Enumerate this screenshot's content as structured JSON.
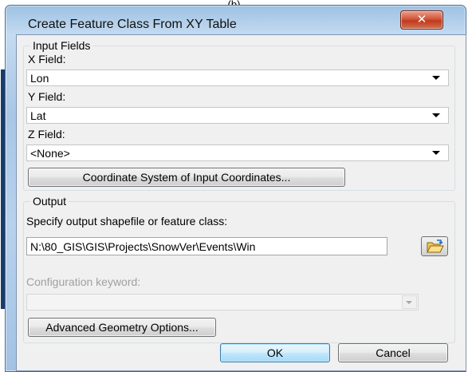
{
  "top_caption": "(b)",
  "window": {
    "title": "Create Feature Class From XY Table",
    "close_glyph": "✕"
  },
  "input_fields": {
    "legend": "Input Fields",
    "x_label": "X Field:",
    "x_value": "Lon",
    "y_label": "Y Field:",
    "y_value": "Lat",
    "z_label": "Z Field:",
    "z_value": "<None>",
    "coord_button": "Coordinate System of Input Coordinates..."
  },
  "output": {
    "legend": "Output",
    "specify_label": "Specify output shapefile or feature class:",
    "path_value": "N:\\80_GIS\\GIS\\Projects\\SnowVer\\Events\\Win",
    "browse_icon": "folder-open-icon",
    "config_label": "Configuration keyword:",
    "config_value": "",
    "advanced_button": "Advanced Geometry Options..."
  },
  "footer": {
    "ok": "OK",
    "cancel": "Cancel"
  },
  "colors": {
    "title_bar": "#b7d2ee",
    "close_button": "#c8472c",
    "client_bg": "#f0f0f0",
    "default_button": "#bee6fd"
  }
}
